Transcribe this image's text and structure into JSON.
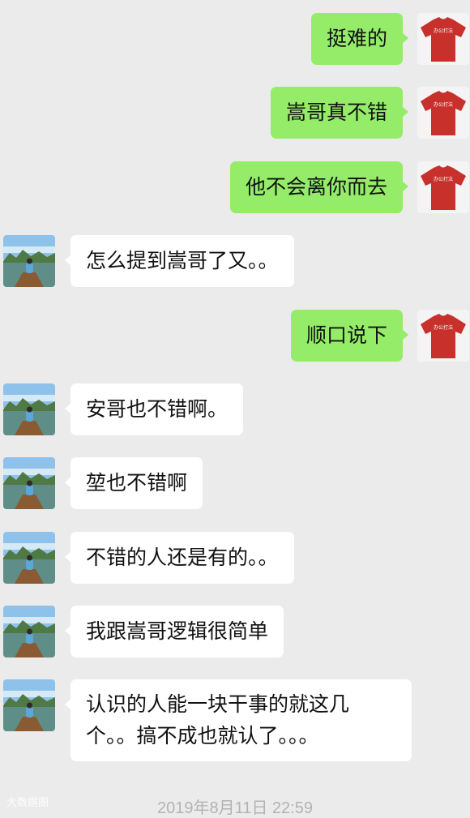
{
  "messages": [
    {
      "side": "out",
      "text": "挺难的",
      "avatar": "red-tshirt-avatar"
    },
    {
      "side": "out",
      "text": "嵩哥真不错",
      "avatar": "red-tshirt-avatar"
    },
    {
      "side": "out",
      "text": "他不会离你而去",
      "avatar": "red-tshirt-avatar"
    },
    {
      "side": "in",
      "text": "怎么提到嵩哥了又。。",
      "avatar": "boat-lake-avatar"
    },
    {
      "side": "out",
      "text": "顺口说下",
      "avatar": "red-tshirt-avatar"
    },
    {
      "side": "in",
      "text": "安哥也不错啊。",
      "avatar": "boat-lake-avatar"
    },
    {
      "side": "in",
      "text": "堃也不错啊",
      "avatar": "boat-lake-avatar"
    },
    {
      "side": "in",
      "text": "不错的人还是有的。。",
      "avatar": "boat-lake-avatar"
    },
    {
      "side": "in",
      "text": "我跟嵩哥逻辑很简单",
      "avatar": "boat-lake-avatar"
    },
    {
      "side": "in",
      "text": "认识的人能一块干事的就这几个。。搞不成也就认了。。。",
      "avatar": "boat-lake-avatar"
    }
  ],
  "timestamp": "2019年8月11日 22:59",
  "watermark": "大数据圈",
  "tshirt_logo_text": "办公打法",
  "colors": {
    "background": "#ebebeb",
    "outgoing_bubble": "#95ec69",
    "incoming_bubble": "#ffffff",
    "tshirt": "#c8302c",
    "timestamp": "#b3b3b3"
  }
}
